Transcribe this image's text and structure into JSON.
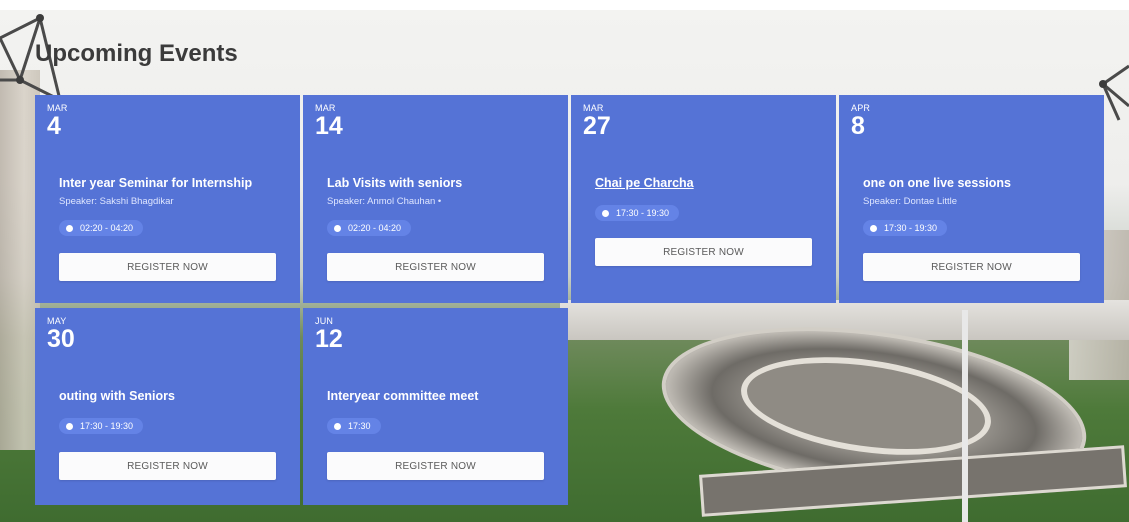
{
  "page": {
    "title": "Upcoming Events"
  },
  "events": [
    {
      "month": "MAR",
      "day": "4",
      "title": "Inter year Seminar for Internship",
      "speaker": "Speaker: Sakshi Bhagdikar",
      "time": "02:20 - 04:20",
      "button": "REGISTER NOW"
    },
    {
      "month": "MAR",
      "day": "14",
      "title": "Lab Visits with seniors",
      "speaker": "Speaker: Anmol Chauhan  •",
      "time": "02:20 - 04:20",
      "button": "REGISTER NOW"
    },
    {
      "month": "MAR",
      "day": "27",
      "title": "Chai pe Charcha",
      "speaker": "",
      "time": "17:30 - 19:30",
      "button": "REGISTER NOW"
    },
    {
      "month": "APR",
      "day": "8",
      "title": "one on one live sessions",
      "speaker": "Speaker: Dontae Little",
      "time": "17:30 - 19:30",
      "button": "REGISTER NOW"
    },
    {
      "month": "MAY",
      "day": "30",
      "title": "outing with Seniors",
      "speaker": "",
      "time": "17:30 - 19:30",
      "button": "REGISTER NOW"
    },
    {
      "month": "JUN",
      "day": "12",
      "title": "Interyear committee meet",
      "speaker": "",
      "time": "17:30",
      "button": "REGISTER NOW"
    }
  ],
  "colors": {
    "card": "#5573d6",
    "pill": "#6483e6",
    "button_bg": "#fbfbfc",
    "title": "#3b3b3b"
  },
  "icons": {
    "time": "clock-icon"
  }
}
